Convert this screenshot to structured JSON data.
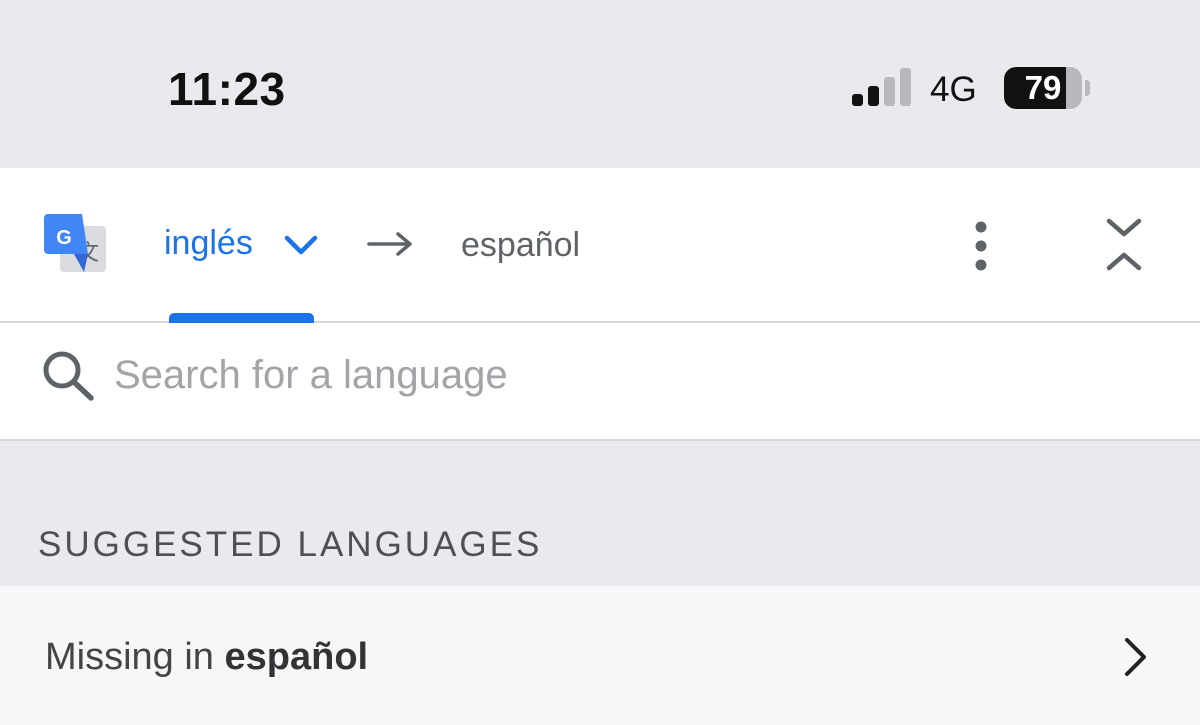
{
  "status_bar": {
    "time": "11:23",
    "network": "4G",
    "battery_level": 79,
    "battery_text": "79",
    "signal_bars_active": 2,
    "signal_bars_total": 4
  },
  "translate_bar": {
    "logo_icon": "google-translate-icon",
    "source_language": "inglés",
    "target_language": "español",
    "arrow_icon": "right-arrow-icon",
    "more_icon": "more-vertical-icon",
    "collapse_icon": "collapse-icon",
    "accent_color": "#1a73e8"
  },
  "search": {
    "placeholder": "Search for a language",
    "value": ""
  },
  "suggested": {
    "header": "SUGGESTED LANGUAGES",
    "items": [
      {
        "prefix": "Missing in ",
        "language": "español"
      }
    ]
  }
}
